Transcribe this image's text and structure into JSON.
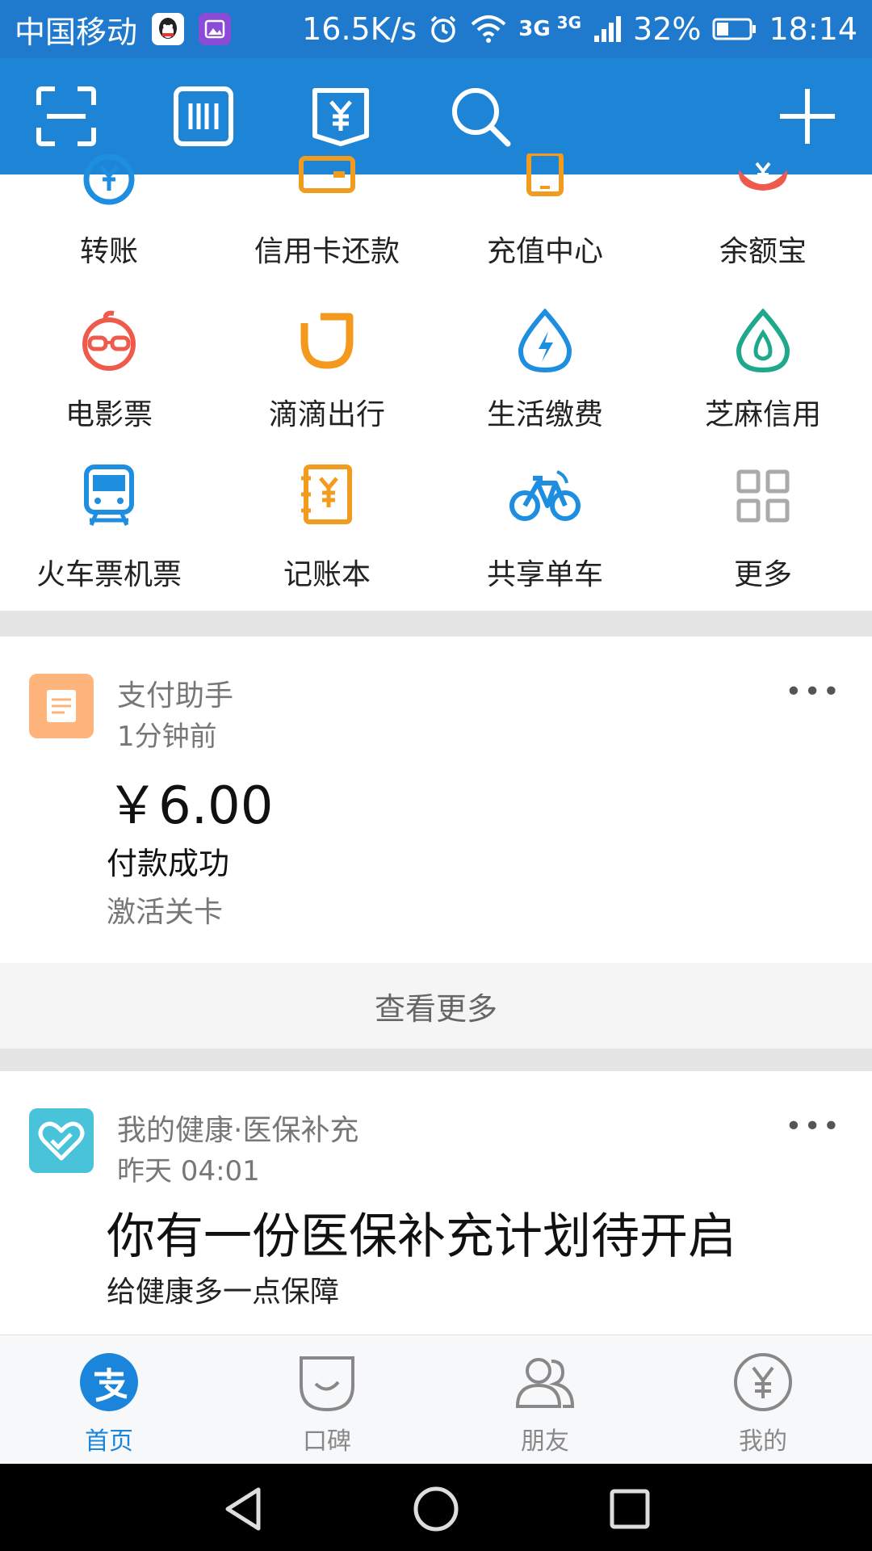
{
  "status": {
    "carrier": "中国移动",
    "net_speed": "16.5K/s",
    "network": "3G",
    "network2": "3G",
    "battery": "32%",
    "time": "18:14"
  },
  "grid": {
    "items": [
      {
        "label": "转账",
        "icon": "transfer-icon"
      },
      {
        "label": "信用卡还款",
        "icon": "credit-card-icon"
      },
      {
        "label": "充值中心",
        "icon": "phone-topup-icon"
      },
      {
        "label": "余额宝",
        "icon": "yuebao-icon"
      },
      {
        "label": "电影票",
        "icon": "movie-ticket-icon"
      },
      {
        "label": "滴滴出行",
        "icon": "didi-icon"
      },
      {
        "label": "生活缴费",
        "icon": "utility-icon"
      },
      {
        "label": "芝麻信用",
        "icon": "sesame-credit-icon"
      },
      {
        "label": "火车票机票",
        "icon": "train-icon"
      },
      {
        "label": "记账本",
        "icon": "ledger-icon"
      },
      {
        "label": "共享单车",
        "icon": "bike-icon"
      },
      {
        "label": "更多",
        "icon": "grid-more-icon"
      }
    ]
  },
  "cards": [
    {
      "source": "支付助手",
      "time": "1分钟前",
      "amount": "￥6.00",
      "title": "付款成功",
      "subtitle": "激活关卡",
      "more": "•••",
      "view_more": "查看更多"
    },
    {
      "source": "我的健康·医保补充",
      "time": "昨天 04:01",
      "title": "你有一份医保补充计划待开启",
      "subtitle": "给健康多一点保障",
      "more": "•••"
    }
  ],
  "tabs": [
    {
      "label": "首页",
      "icon": "alipay-home-icon",
      "active": true
    },
    {
      "label": "口碑",
      "icon": "koubei-icon"
    },
    {
      "label": "朋友",
      "icon": "friends-icon"
    },
    {
      "label": "我的",
      "icon": "yuan-me-icon"
    }
  ],
  "colors": {
    "brand_blue": "#1e84d6",
    "status_blue": "#1f7acd",
    "active_tab": "#1a85da",
    "inactive_tab": "#888888"
  }
}
